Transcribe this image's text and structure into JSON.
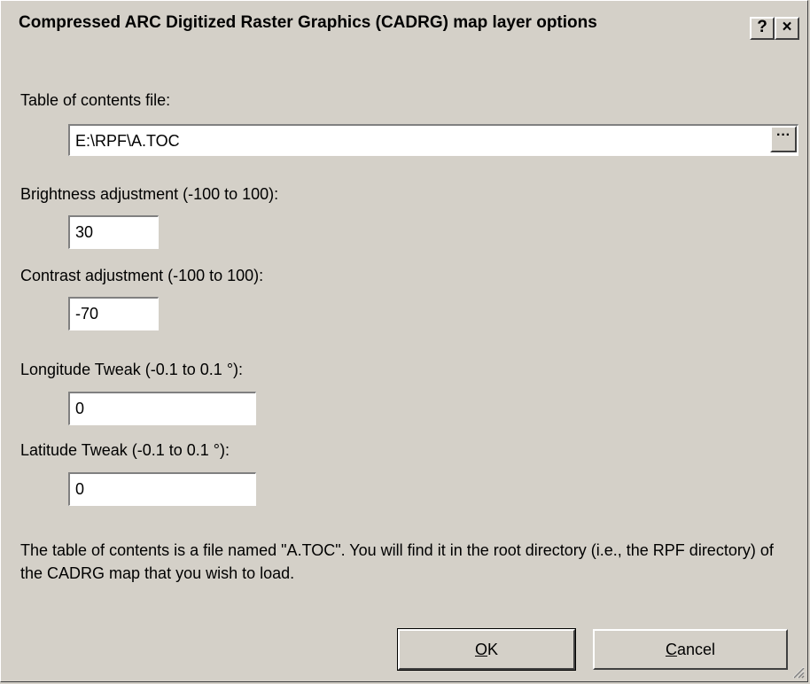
{
  "window": {
    "title": "Compressed ARC Digitized Raster Graphics (CADRG) map layer options",
    "help_label": "?",
    "close_label": "×"
  },
  "toc": {
    "label": "Table of contents file:",
    "value": "E:\\RPF\\A.TOC",
    "browse_label": "···"
  },
  "brightness": {
    "label": "Brightness adjustment (-100 to 100):",
    "value": "30"
  },
  "contrast": {
    "label": "Contrast adjustment (-100 to 100):",
    "value": "-70"
  },
  "longitude": {
    "label": "Longitude Tweak (-0.1 to 0.1 °):",
    "value": "0"
  },
  "latitude": {
    "label": "Latitude Tweak (-0.1 to 0.1 °):",
    "value": "0"
  },
  "description": "The table of contents is a file named \"A.TOC\".  You will find it in the root directory (i.e., the RPF directory) of the CADRG map that you wish to load.",
  "buttons": {
    "ok_mnemonic": "O",
    "ok_rest": "K",
    "cancel_mnemonic": "C",
    "cancel_rest": "ancel"
  }
}
